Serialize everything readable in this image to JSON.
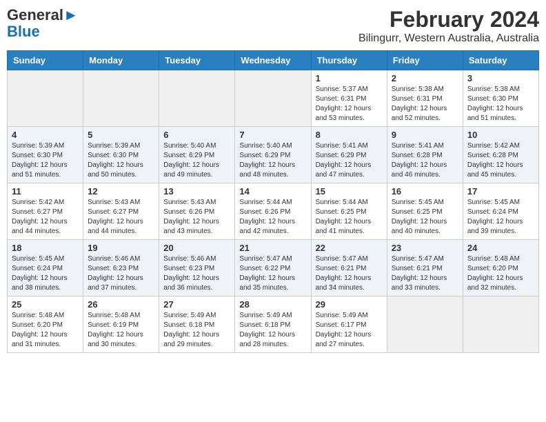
{
  "header": {
    "logo_line1": "General",
    "logo_line2": "Blue",
    "title": "February 2024",
    "subtitle": "Bilingurr, Western Australia, Australia"
  },
  "weekdays": [
    "Sunday",
    "Monday",
    "Tuesday",
    "Wednesday",
    "Thursday",
    "Friday",
    "Saturday"
  ],
  "weeks": [
    [
      {
        "day": "",
        "info": ""
      },
      {
        "day": "",
        "info": ""
      },
      {
        "day": "",
        "info": ""
      },
      {
        "day": "",
        "info": ""
      },
      {
        "day": "1",
        "info": "Sunrise: 5:37 AM\nSunset: 6:31 PM\nDaylight: 12 hours\nand 53 minutes."
      },
      {
        "day": "2",
        "info": "Sunrise: 5:38 AM\nSunset: 6:31 PM\nDaylight: 12 hours\nand 52 minutes."
      },
      {
        "day": "3",
        "info": "Sunrise: 5:38 AM\nSunset: 6:30 PM\nDaylight: 12 hours\nand 51 minutes."
      }
    ],
    [
      {
        "day": "4",
        "info": "Sunrise: 5:39 AM\nSunset: 6:30 PM\nDaylight: 12 hours\nand 51 minutes."
      },
      {
        "day": "5",
        "info": "Sunrise: 5:39 AM\nSunset: 6:30 PM\nDaylight: 12 hours\nand 50 minutes."
      },
      {
        "day": "6",
        "info": "Sunrise: 5:40 AM\nSunset: 6:29 PM\nDaylight: 12 hours\nand 49 minutes."
      },
      {
        "day": "7",
        "info": "Sunrise: 5:40 AM\nSunset: 6:29 PM\nDaylight: 12 hours\nand 48 minutes."
      },
      {
        "day": "8",
        "info": "Sunrise: 5:41 AM\nSunset: 6:29 PM\nDaylight: 12 hours\nand 47 minutes."
      },
      {
        "day": "9",
        "info": "Sunrise: 5:41 AM\nSunset: 6:28 PM\nDaylight: 12 hours\nand 46 minutes."
      },
      {
        "day": "10",
        "info": "Sunrise: 5:42 AM\nSunset: 6:28 PM\nDaylight: 12 hours\nand 45 minutes."
      }
    ],
    [
      {
        "day": "11",
        "info": "Sunrise: 5:42 AM\nSunset: 6:27 PM\nDaylight: 12 hours\nand 44 minutes."
      },
      {
        "day": "12",
        "info": "Sunrise: 5:43 AM\nSunset: 6:27 PM\nDaylight: 12 hours\nand 44 minutes."
      },
      {
        "day": "13",
        "info": "Sunrise: 5:43 AM\nSunset: 6:26 PM\nDaylight: 12 hours\nand 43 minutes."
      },
      {
        "day": "14",
        "info": "Sunrise: 5:44 AM\nSunset: 6:26 PM\nDaylight: 12 hours\nand 42 minutes."
      },
      {
        "day": "15",
        "info": "Sunrise: 5:44 AM\nSunset: 6:25 PM\nDaylight: 12 hours\nand 41 minutes."
      },
      {
        "day": "16",
        "info": "Sunrise: 5:45 AM\nSunset: 6:25 PM\nDaylight: 12 hours\nand 40 minutes."
      },
      {
        "day": "17",
        "info": "Sunrise: 5:45 AM\nSunset: 6:24 PM\nDaylight: 12 hours\nand 39 minutes."
      }
    ],
    [
      {
        "day": "18",
        "info": "Sunrise: 5:45 AM\nSunset: 6:24 PM\nDaylight: 12 hours\nand 38 minutes."
      },
      {
        "day": "19",
        "info": "Sunrise: 5:46 AM\nSunset: 6:23 PM\nDaylight: 12 hours\nand 37 minutes."
      },
      {
        "day": "20",
        "info": "Sunrise: 5:46 AM\nSunset: 6:23 PM\nDaylight: 12 hours\nand 36 minutes."
      },
      {
        "day": "21",
        "info": "Sunrise: 5:47 AM\nSunset: 6:22 PM\nDaylight: 12 hours\nand 35 minutes."
      },
      {
        "day": "22",
        "info": "Sunrise: 5:47 AM\nSunset: 6:21 PM\nDaylight: 12 hours\nand 34 minutes."
      },
      {
        "day": "23",
        "info": "Sunrise: 5:47 AM\nSunset: 6:21 PM\nDaylight: 12 hours\nand 33 minutes."
      },
      {
        "day": "24",
        "info": "Sunrise: 5:48 AM\nSunset: 6:20 PM\nDaylight: 12 hours\nand 32 minutes."
      }
    ],
    [
      {
        "day": "25",
        "info": "Sunrise: 5:48 AM\nSunset: 6:20 PM\nDaylight: 12 hours\nand 31 minutes."
      },
      {
        "day": "26",
        "info": "Sunrise: 5:48 AM\nSunset: 6:19 PM\nDaylight: 12 hours\nand 30 minutes."
      },
      {
        "day": "27",
        "info": "Sunrise: 5:49 AM\nSunset: 6:18 PM\nDaylight: 12 hours\nand 29 minutes."
      },
      {
        "day": "28",
        "info": "Sunrise: 5:49 AM\nSunset: 6:18 PM\nDaylight: 12 hours\nand 28 minutes."
      },
      {
        "day": "29",
        "info": "Sunrise: 5:49 AM\nSunset: 6:17 PM\nDaylight: 12 hours\nand 27 minutes."
      },
      {
        "day": "",
        "info": ""
      },
      {
        "day": "",
        "info": ""
      }
    ]
  ]
}
